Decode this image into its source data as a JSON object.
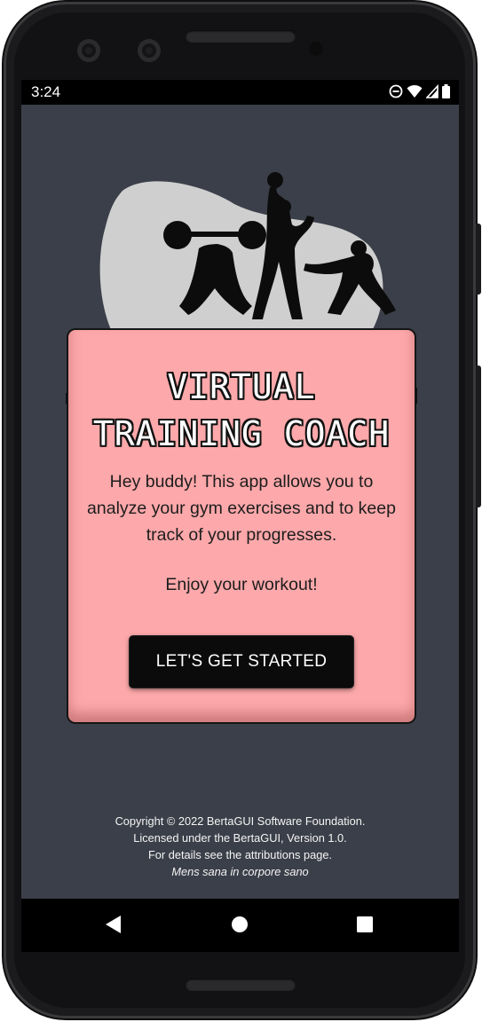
{
  "statusbar": {
    "time": "3:24"
  },
  "card": {
    "title_line1": "VIRTUAL",
    "title_line2": "TRAINING COACH",
    "intro": "Hey buddy! This app allows you to analyze your gym exercises and to keep track of your progresses.",
    "enjoy": "Enjoy your workout!",
    "cta_label": "LET'S GET STARTED"
  },
  "footer": {
    "line1": "Copyright © 2022 BertaGUI Software Foundation.",
    "line2": "Licensed under the BertaGUI, Version 1.0.",
    "line3": "For details see the attributions page.",
    "motto": "Mens sana in corpore sano"
  },
  "icons": {
    "status": [
      "dnd-icon",
      "wifi-icon",
      "signal-icon",
      "battery-icon"
    ],
    "nav": [
      "back-icon",
      "home-icon",
      "recents-icon"
    ]
  },
  "colors": {
    "screen_bg": "#3b3f49",
    "card_bg": "#fda8aa",
    "button_bg": "#0b0b0c",
    "blob": "#cfcfcf"
  }
}
